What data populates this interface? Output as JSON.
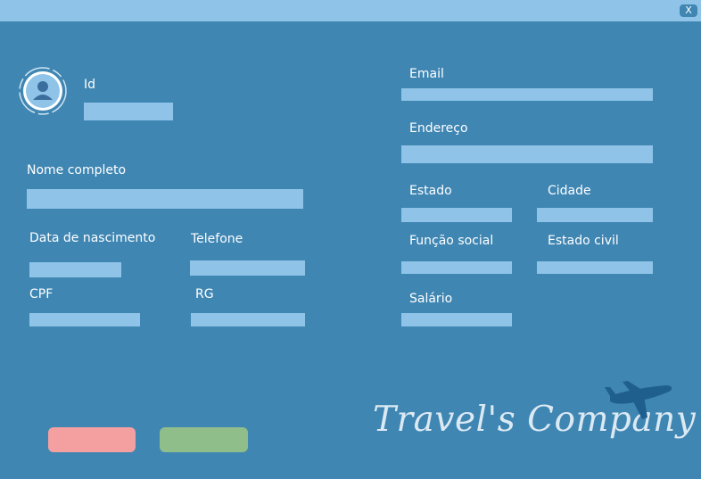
{
  "window": {
    "close_label": "X"
  },
  "form": {
    "id_label": "Id",
    "nome_label": "Nome completo",
    "nascimento_label": "Data de nascimento",
    "telefone_label": "Telefone",
    "cpf_label": "CPF",
    "rg_label": "RG",
    "email_label": "Email",
    "endereco_label": "Endereço",
    "estado_label": "Estado",
    "cidade_label": "Cidade",
    "funcao_label": "Função social",
    "estado_civil_label": "Estado civil",
    "salario_label": "Salário",
    "id_value": "",
    "nome_value": "",
    "nascimento_value": "",
    "telefone_value": "",
    "cpf_value": "",
    "rg_value": "",
    "email_value": "",
    "endereco_value": "",
    "estado_value": "",
    "cidade_value": "",
    "funcao_value": "",
    "estado_civil_value": "",
    "salario_value": ""
  },
  "actions": {
    "cancel_label": "",
    "save_label": ""
  },
  "branding": {
    "logo_text": "Travel's Company"
  },
  "colors": {
    "background": "#3f86b3",
    "field": "#8fc4e8",
    "cancel": "#f4a0a0",
    "save": "#8fbe8a"
  },
  "icons": {
    "avatar": "user-avatar-icon",
    "plane": "airplane-icon",
    "close": "close-icon"
  }
}
